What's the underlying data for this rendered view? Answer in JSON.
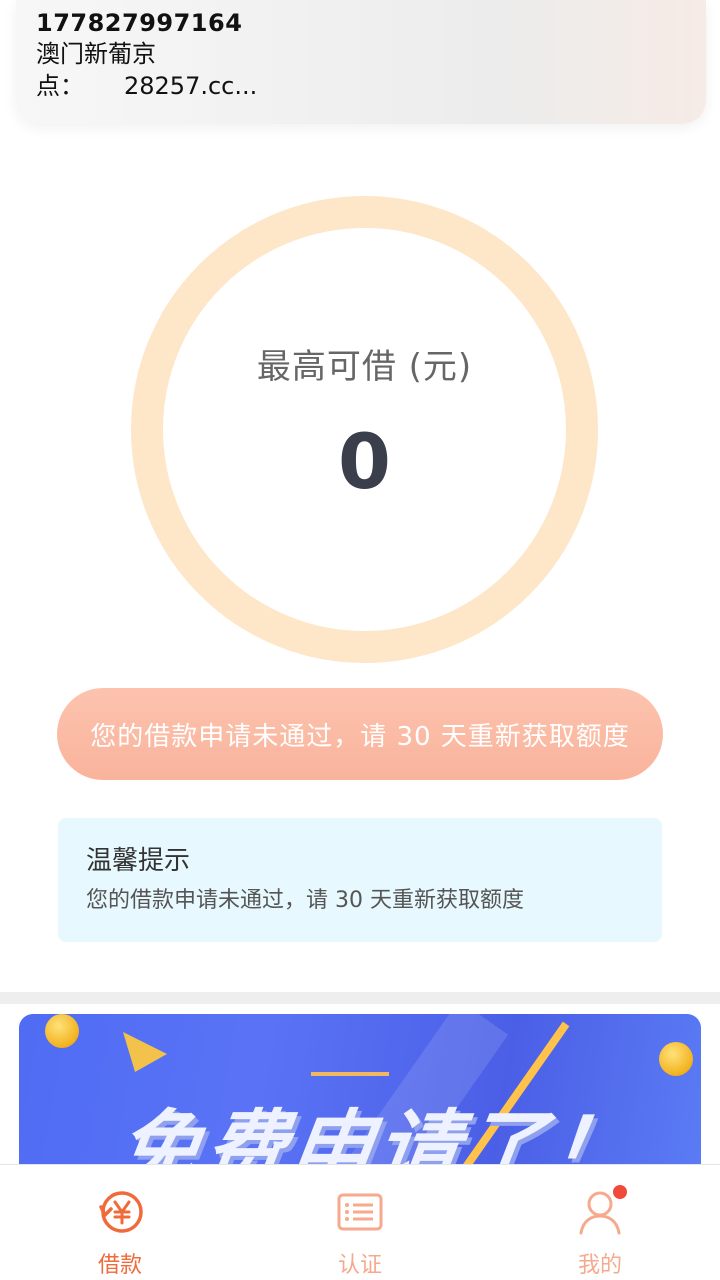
{
  "notification": {
    "title": "177827997164",
    "line1": "澳门新葡京",
    "line2_prefix": "点：",
    "line2_value": "28257.cc..."
  },
  "limit": {
    "label": "最高可借 (元)",
    "value": "0"
  },
  "status_button": {
    "label": "您的借款申请未通过，请 30 天重新获取额度"
  },
  "tip": {
    "title": "温馨提示",
    "text": "您的借款申请未通过，请 30 天重新获取额度"
  },
  "banner": {
    "text": "免费申请了！"
  },
  "tabbar": {
    "items": [
      {
        "label": "借款",
        "icon": "loan-yuan-icon",
        "active": true
      },
      {
        "label": "认证",
        "icon": "certification-list-icon",
        "active": false
      },
      {
        "label": "我的",
        "icon": "profile-person-icon",
        "active": false
      }
    ]
  },
  "colors": {
    "accent": "#f06a3a",
    "ring": "#fee6c8",
    "pill": "#f9b39c",
    "tip_bg": "#e7f8fe",
    "banner": "#4f6cf3"
  }
}
